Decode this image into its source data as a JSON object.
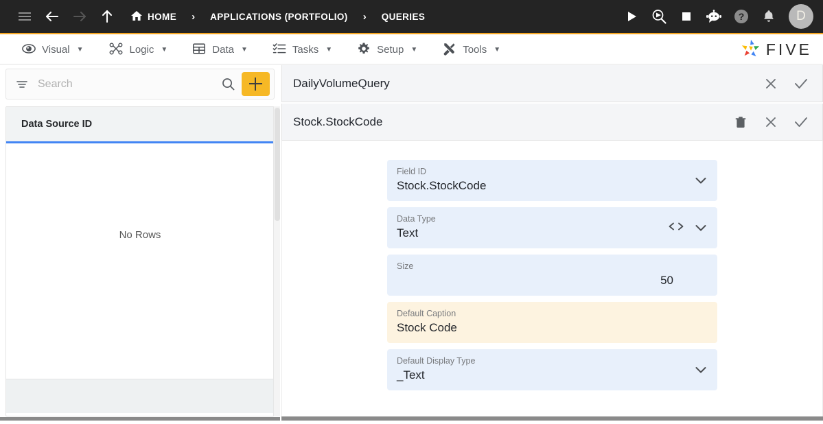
{
  "topbar": {
    "nav_icons": [
      {
        "name": "menu-icon",
        "label": "Menu"
      },
      {
        "name": "back-arrow-icon",
        "label": "Back"
      },
      {
        "name": "forward-arrow-icon",
        "label": "Forward"
      },
      {
        "name": "up-arrow-icon",
        "label": "Up"
      }
    ],
    "breadcrumbs": [
      {
        "label": "HOME",
        "icon": "home-icon"
      },
      {
        "label": "APPLICATIONS (PORTFOLIO)",
        "icon": ""
      },
      {
        "label": "QUERIES",
        "icon": ""
      }
    ],
    "separator": "›",
    "right_icons": [
      {
        "name": "play-icon",
        "label": "Run"
      },
      {
        "name": "debug-search-icon",
        "label": "Debug"
      },
      {
        "name": "stop-icon",
        "label": "Stop"
      },
      {
        "name": "chatbot-icon",
        "label": "Assistant"
      },
      {
        "name": "help-icon",
        "label": "Help"
      },
      {
        "name": "bell-icon",
        "label": "Notifications"
      }
    ],
    "avatar_initial": "D",
    "accent_bar_color": "#f5a623",
    "background_color": "#242424"
  },
  "menubar": {
    "items": [
      {
        "label": "Visual",
        "icon": "eye-icon",
        "caret": "▼"
      },
      {
        "label": "Logic",
        "icon": "logic-nodes-icon",
        "caret": "▼"
      },
      {
        "label": "Data",
        "icon": "table-icon",
        "caret": "▼"
      },
      {
        "label": "Tasks",
        "icon": "checklist-icon",
        "caret": "▼"
      },
      {
        "label": "Setup",
        "icon": "gear-icon",
        "caret": "▼"
      },
      {
        "label": "Tools",
        "icon": "tools-icon",
        "caret": "▼"
      }
    ],
    "logo_text": "FIVE",
    "logo_icon": "five-pinwheel-logo"
  },
  "left_panel": {
    "search": {
      "placeholder": "Search",
      "value": "",
      "filter_icon": "filter-icon",
      "search_icon": "search-icon"
    },
    "add_button": {
      "icon": "plus-icon",
      "color": "#f6b825"
    },
    "grid": {
      "column_header": "Data Source ID",
      "empty_message": "No Rows",
      "header_underline_color": "#4285f4",
      "rows": []
    }
  },
  "right_panel": {
    "query_header": {
      "title": "DailyVolumeQuery",
      "actions": [
        {
          "name": "close-icon",
          "label": "Close"
        },
        {
          "name": "check-icon",
          "label": "Save"
        }
      ]
    },
    "field_header": {
      "title": "Stock.StockCode",
      "actions": [
        {
          "name": "delete-icon",
          "label": "Delete"
        },
        {
          "name": "close-icon",
          "label": "Close"
        },
        {
          "name": "check-icon",
          "label": "Save"
        }
      ]
    },
    "form_fields": [
      {
        "label": "Field ID",
        "value": "Stock.StockCode",
        "style": "blue",
        "align": "left",
        "icons": [
          "chevron-down-icon"
        ]
      },
      {
        "label": "Data Type",
        "value": "Text",
        "style": "blue",
        "align": "left",
        "icons": [
          "code-brackets-icon",
          "chevron-down-icon"
        ]
      },
      {
        "label": "Size",
        "value": "50",
        "style": "blue",
        "align": "right",
        "icons": []
      },
      {
        "label": "Default Caption",
        "value": "Stock Code",
        "style": "cream",
        "align": "left",
        "icons": []
      },
      {
        "label": "Default Display Type",
        "value": "_Text",
        "style": "blue",
        "align": "left",
        "icons": [
          "chevron-down-icon"
        ]
      }
    ]
  },
  "colors": {
    "field_blue": "#e8f0fb",
    "field_cream": "#fdf3e0",
    "accent_yellow": "#f6b825",
    "accent_blue": "#4285f4",
    "header_gray": "#f4f5f7"
  }
}
